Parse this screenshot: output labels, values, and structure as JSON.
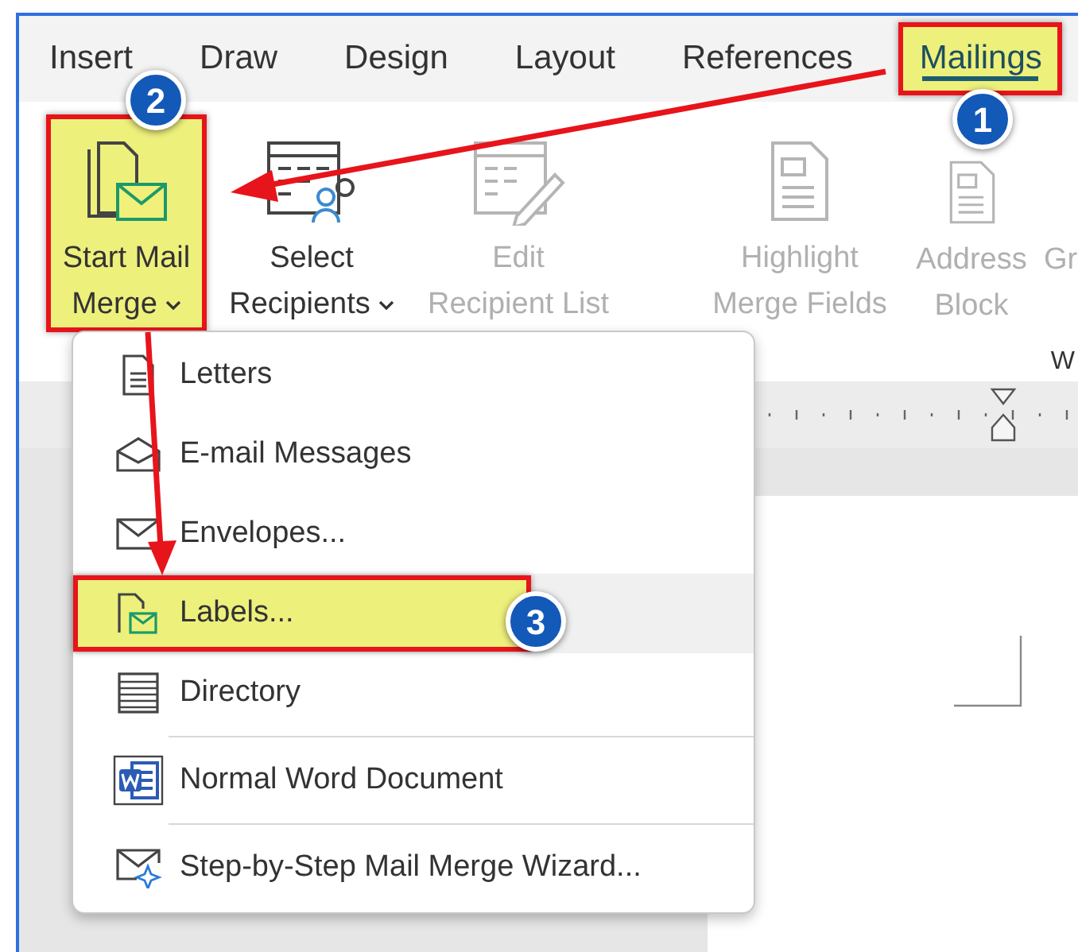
{
  "tabs": [
    {
      "label": "Insert",
      "selected": false,
      "highlighted": false
    },
    {
      "label": "Draw",
      "selected": false,
      "highlighted": false
    },
    {
      "label": "Design",
      "selected": false,
      "highlighted": false
    },
    {
      "label": "Layout",
      "selected": false,
      "highlighted": false
    },
    {
      "label": "References",
      "selected": false,
      "highlighted": false
    },
    {
      "label": "Mailings",
      "selected": true,
      "highlighted": true,
      "callout": "1"
    }
  ],
  "ribbon": {
    "buttons": [
      {
        "kind": "start-merge",
        "lines": [
          "Start Mail",
          "Merge"
        ],
        "dropdown": true,
        "disabled": false,
        "highlighted": true,
        "callout": "2"
      },
      {
        "kind": "recipients",
        "lines": [
          "Select",
          "Recipients"
        ],
        "dropdown": true,
        "disabled": false,
        "highlighted": false
      },
      {
        "kind": "edit-list",
        "lines": [
          "Edit",
          "Recipient List"
        ],
        "dropdown": false,
        "disabled": true,
        "highlighted": false
      },
      {
        "kind": "highlight-fields",
        "lines": [
          "Highlight",
          "Merge Fields"
        ],
        "dropdown": false,
        "disabled": true,
        "highlighted": false
      },
      {
        "kind": "address-block",
        "lines": [
          "Address",
          "Block"
        ],
        "dropdown": false,
        "disabled": true,
        "highlighted": false
      },
      {
        "kind": "cut",
        "lines": [
          "Gr"
        ],
        "dropdown": false,
        "disabled": true,
        "highlighted": false
      }
    ],
    "group_label": "W"
  },
  "menu": {
    "items": [
      {
        "kind": "letters",
        "label": "Letters",
        "hovered": false,
        "highlighted": false,
        "divider_above": false
      },
      {
        "kind": "email",
        "label": "E-mail Messages",
        "hovered": false,
        "highlighted": false,
        "divider_above": false
      },
      {
        "kind": "envelopes",
        "label": "Envelopes...",
        "hovered": false,
        "highlighted": false,
        "divider_above": false
      },
      {
        "kind": "labels",
        "label": "Labels...",
        "hovered": true,
        "highlighted": true,
        "divider_above": false,
        "callout": "3"
      },
      {
        "kind": "directory",
        "label": "Directory",
        "hovered": false,
        "highlighted": false,
        "divider_above": false
      },
      {
        "kind": "word",
        "label": "Normal Word Document",
        "hovered": false,
        "highlighted": false,
        "divider_above": true
      },
      {
        "kind": "wizard",
        "label": "Step-by-Step Mail Merge Wizard...",
        "hovered": false,
        "highlighted": false,
        "divider_above": true
      }
    ]
  }
}
